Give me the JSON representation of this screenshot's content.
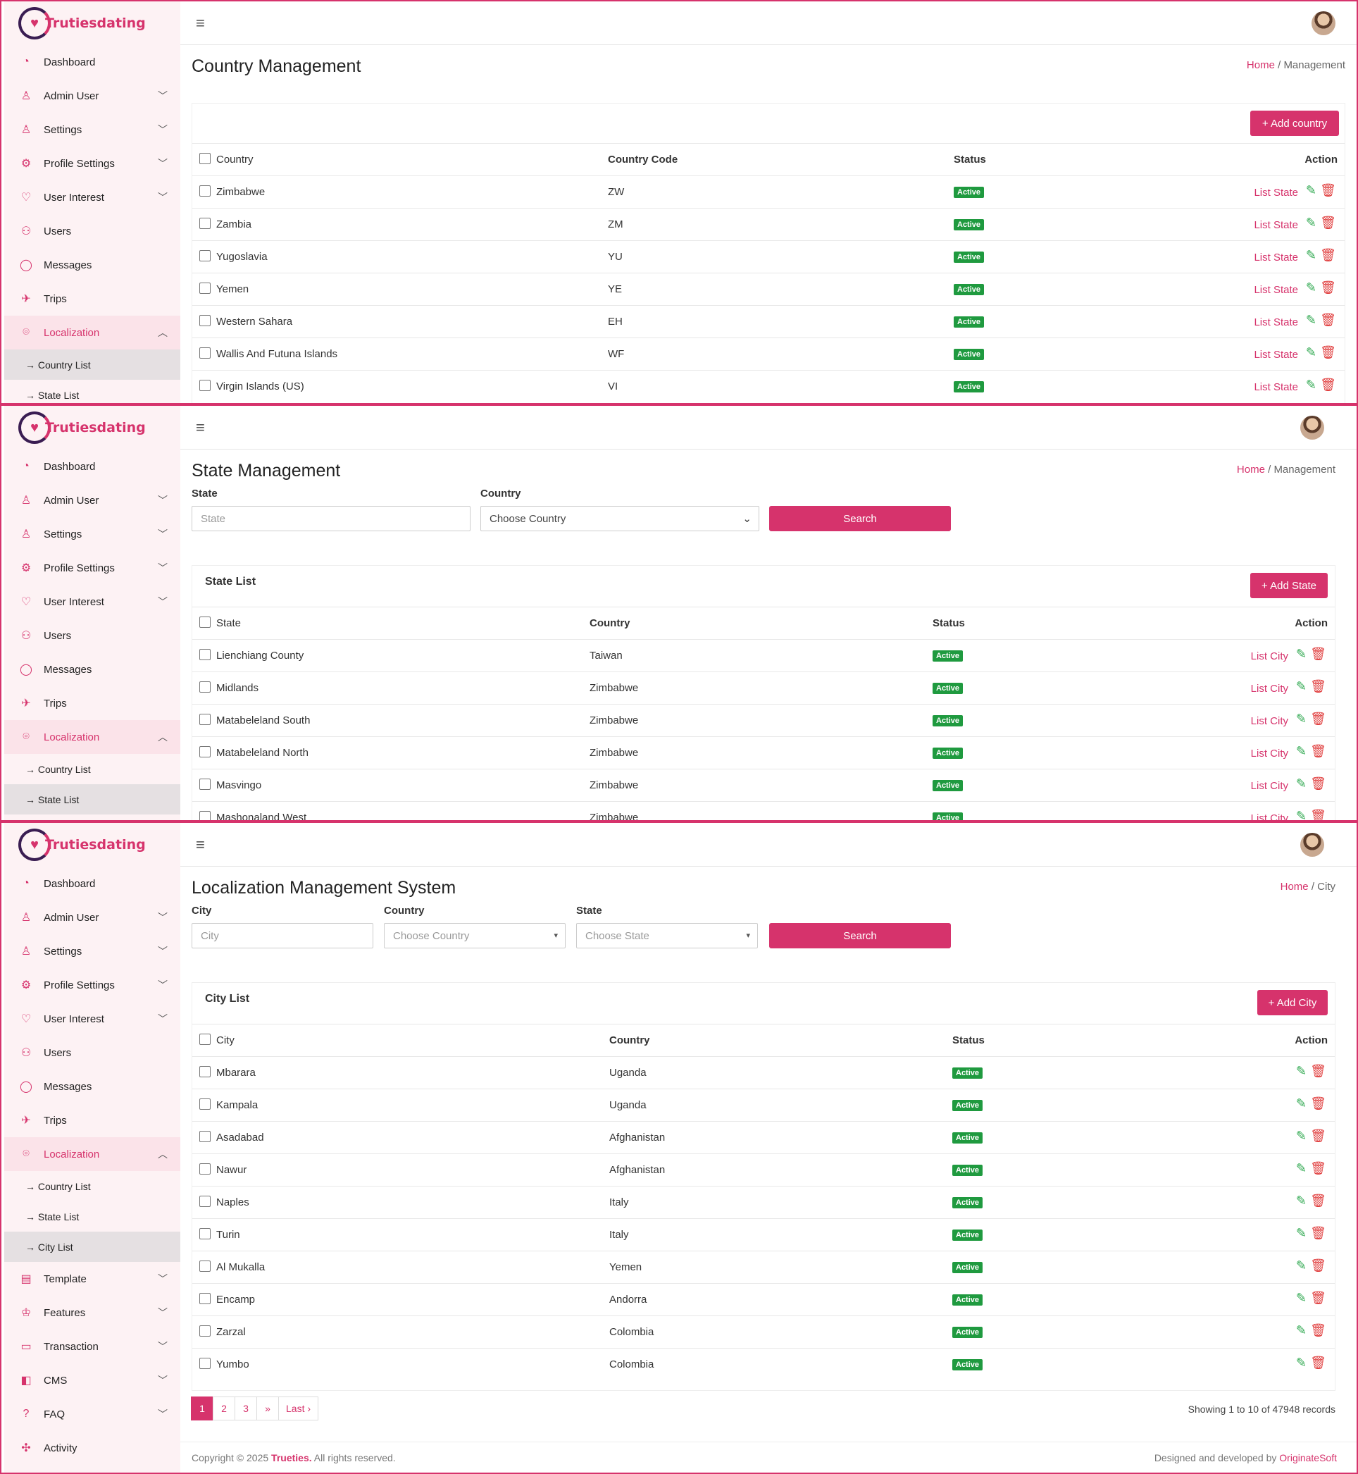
{
  "brand": {
    "name": "Trutiesdating"
  },
  "nav": {
    "dashboard": "Dashboard",
    "admin_user": "Admin User",
    "settings": "Settings",
    "profile_settings": "Profile Settings",
    "user_interest": "User Interest",
    "users": "Users",
    "messages": "Messages",
    "trips": "Trips",
    "localization": "Localization",
    "country_list": "→ Country List",
    "state_list": "→ State List",
    "city_list": "→ City List",
    "template": "Template",
    "features": "Features",
    "transaction": "Transaction",
    "cms": "CMS",
    "faq": "FAQ",
    "activity": "Activity"
  },
  "breadcrumb": {
    "home": "Home",
    "sep": "/",
    "management": "Management",
    "city": "City"
  },
  "country_page": {
    "title": "Country Management",
    "add_button": "+ Add country",
    "headers": {
      "country": "Country",
      "code": "Country Code",
      "status": "Status",
      "action": "Action"
    },
    "rows": [
      {
        "name": "Zimbabwe",
        "code": "ZW",
        "status": "Active"
      },
      {
        "name": "Zambia",
        "code": "ZM",
        "status": "Active"
      },
      {
        "name": "Yugoslavia",
        "code": "YU",
        "status": "Active"
      },
      {
        "name": "Yemen",
        "code": "YE",
        "status": "Active"
      },
      {
        "name": "Western Sahara",
        "code": "EH",
        "status": "Active"
      },
      {
        "name": "Wallis And Futuna Islands",
        "code": "WF",
        "status": "Active"
      },
      {
        "name": "Virgin Islands (US)",
        "code": "VI",
        "status": "Active"
      }
    ],
    "row_link": "List State"
  },
  "state_page": {
    "title": "State Management",
    "filters": {
      "state_label": "State",
      "state_placeholder": "State",
      "country_label": "Country",
      "country_select": "Choose Country",
      "search": "Search"
    },
    "list_title": "State List",
    "add_button": "+ Add State",
    "headers": {
      "state": "State",
      "country": "Country",
      "status": "Status",
      "action": "Action"
    },
    "rows": [
      {
        "name": "Lienchiang County",
        "country": "Taiwan",
        "status": "Active"
      },
      {
        "name": "Midlands",
        "country": "Zimbabwe",
        "status": "Active"
      },
      {
        "name": "Matabeleland South",
        "country": "Zimbabwe",
        "status": "Active"
      },
      {
        "name": "Matabeleland North",
        "country": "Zimbabwe",
        "status": "Active"
      },
      {
        "name": "Masvingo",
        "country": "Zimbabwe",
        "status": "Active"
      },
      {
        "name": "Mashonaland West",
        "country": "Zimbabwe",
        "status": "Active"
      }
    ],
    "row_link": "List City"
  },
  "city_page": {
    "title": "Localization Management System",
    "filters": {
      "city_label": "City",
      "city_placeholder": "City",
      "country_label": "Country",
      "country_select": "Choose Country",
      "state_label": "State",
      "state_select": "Choose State",
      "search": "Search"
    },
    "list_title": "City List",
    "add_button": "+ Add City",
    "headers": {
      "city": "City",
      "country": "Country",
      "status": "Status",
      "action": "Action"
    },
    "rows": [
      {
        "name": "Mbarara",
        "country": "Uganda",
        "status": "Active"
      },
      {
        "name": "Kampala",
        "country": "Uganda",
        "status": "Active"
      },
      {
        "name": "Asadabad",
        "country": "Afghanistan",
        "status": "Active"
      },
      {
        "name": "Nawur",
        "country": "Afghanistan",
        "status": "Active"
      },
      {
        "name": "Naples",
        "country": "Italy",
        "status": "Active"
      },
      {
        "name": "Turin",
        "country": "Italy",
        "status": "Active"
      },
      {
        "name": "Al Mukalla",
        "country": "Yemen",
        "status": "Active"
      },
      {
        "name": "Encamp",
        "country": "Andorra",
        "status": "Active"
      },
      {
        "name": "Zarzal",
        "country": "Colombia",
        "status": "Active"
      },
      {
        "name": "Yumbo",
        "country": "Colombia",
        "status": "Active"
      }
    ],
    "pagination": [
      "1",
      "2",
      "3",
      "»",
      "Last ›"
    ],
    "showing": "Showing 1 to 10 of 47948 records"
  },
  "footer": {
    "copyright": "Copyright © 2025",
    "brand": "Trueties.",
    "rights": "All rights reserved.",
    "designed": "Designed and developed by",
    "company": "OriginateSoft"
  },
  "icons": {
    "menu": "hamburger-icon",
    "edit": "edit-icon",
    "delete": "trash-icon"
  },
  "colors": {
    "accent": "#d6336c",
    "active": "#1f9a3f"
  }
}
